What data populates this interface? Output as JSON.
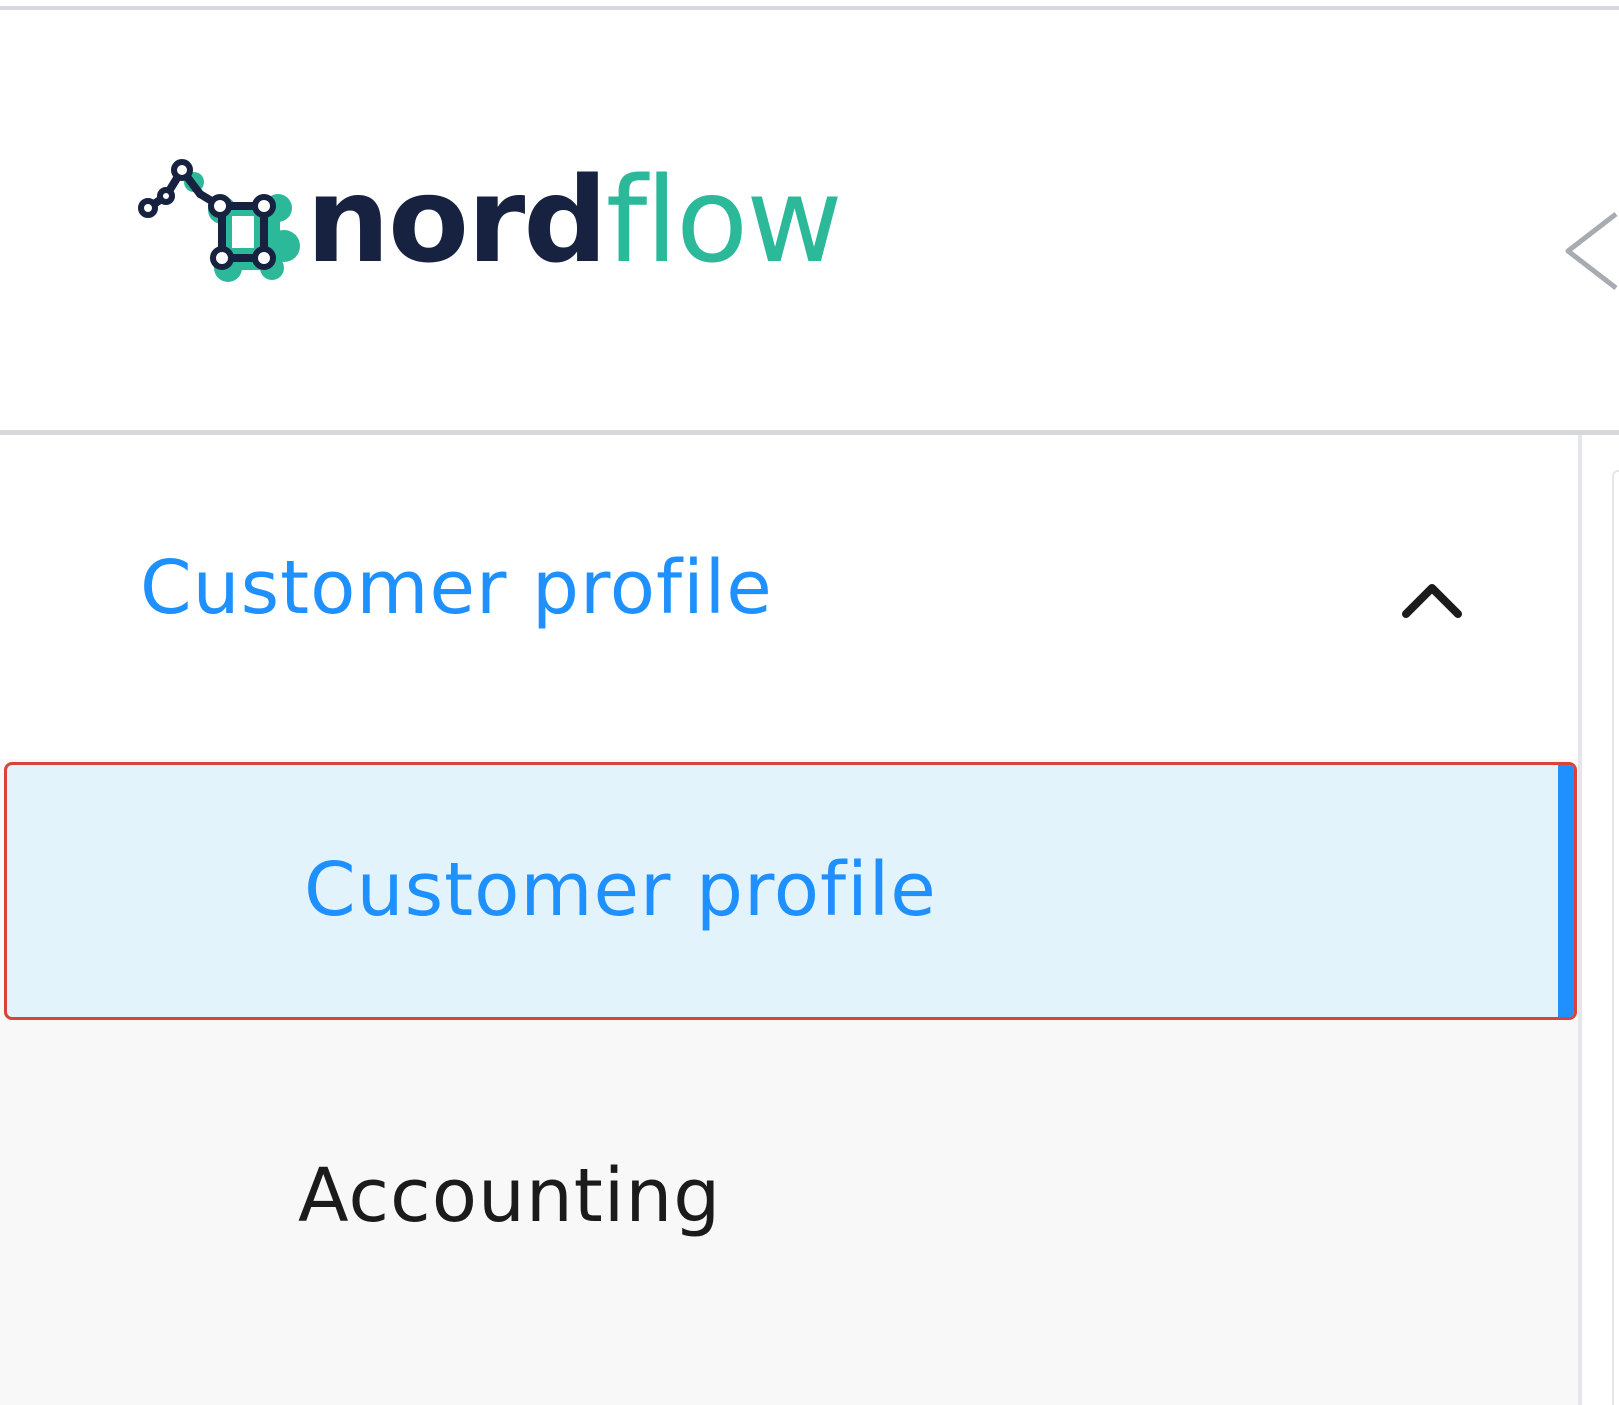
{
  "brand": {
    "name_bold": "nord",
    "name_light": "flow",
    "colors": {
      "dark": "#16223f",
      "teal": "#2bb99a"
    },
    "logo_icon": "network-nodes-logo-icon"
  },
  "header": {
    "collapse_icon": "chevron-left-icon"
  },
  "sidebar": {
    "group": {
      "label": "Customer profile",
      "expanded": true,
      "chevron_icon": "chevron-up-icon",
      "color": "#1e90ff"
    },
    "items": [
      {
        "label": "Customer profile",
        "active": true
      },
      {
        "label": "Accounting",
        "active": false
      }
    ],
    "active_color": "#1e90ff",
    "active_background": "#e3f3fc",
    "highlight_border": "#d8433a"
  }
}
